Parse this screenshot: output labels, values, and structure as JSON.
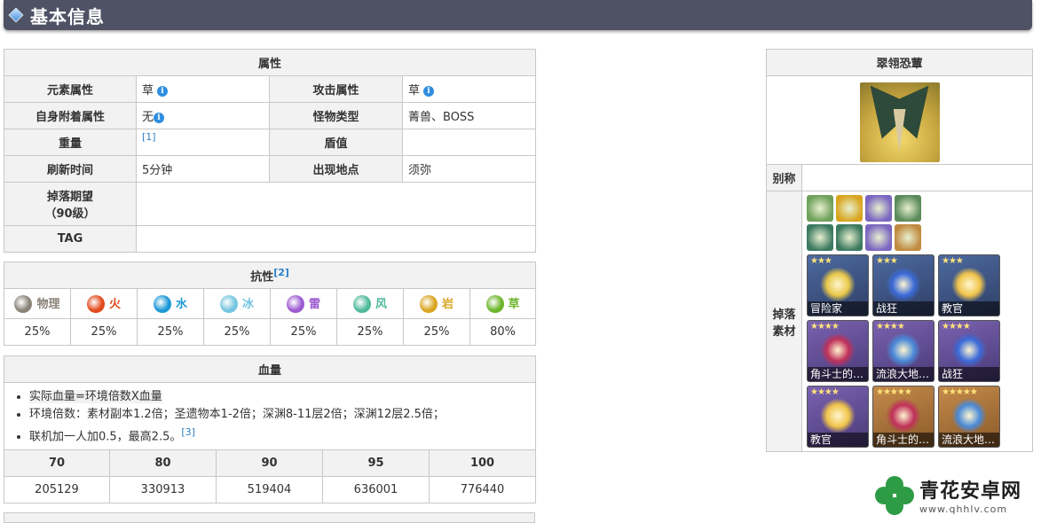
{
  "header": {
    "title": "基本信息"
  },
  "attributes": {
    "title": "属性",
    "rows": [
      {
        "l1": "元素属性",
        "v1": "草",
        "l2": "攻击属性",
        "v2": "草"
      },
      {
        "l1": "自身附着属性",
        "v1": "无",
        "l2": "怪物类型",
        "v2": "菁兽、BOSS"
      },
      {
        "l1": "重量",
        "v1": "",
        "ref1": "[1]",
        "l2": "盾值",
        "v2": ""
      },
      {
        "l1": "刷新时间",
        "v1": "5分钟",
        "l2": "出现地点",
        "v2": "须弥"
      }
    ],
    "drop_label": "掉落期望\n（90级）",
    "drop_label_line1": "掉落期望",
    "drop_label_line2": "（90级）",
    "tag_label": "TAG"
  },
  "resistance": {
    "title": "抗性",
    "ref": "[2]",
    "elements": [
      {
        "name": "物理",
        "color": "#8a8276",
        "value": "25%"
      },
      {
        "name": "火",
        "color": "#e2491a",
        "value": "25%"
      },
      {
        "name": "水",
        "color": "#1c98d6",
        "value": "25%"
      },
      {
        "name": "冰",
        "color": "#74c6e0",
        "value": "25%"
      },
      {
        "name": "雷",
        "color": "#9c5ad1",
        "value": "25%"
      },
      {
        "name": "风",
        "color": "#4fba9a",
        "value": "25%"
      },
      {
        "name": "岩",
        "color": "#d9a520",
        "value": "25%"
      },
      {
        "name": "草",
        "color": "#6cb52a",
        "value": "80%"
      }
    ]
  },
  "hp": {
    "title": "血量",
    "notes": [
      "实际血量=环境倍数X血量",
      "环境倍数：素材副本1.2倍；圣遗物本1-2倍；深渊8-11层2倍；深渊12层2.5倍；",
      "联机加一人加0.5，最高2.5。"
    ],
    "note_ref": "[3]",
    "levels": [
      "70",
      "80",
      "90",
      "95",
      "100"
    ],
    "values": [
      "205129",
      "330913",
      "519404",
      "636001",
      "776440"
    ]
  },
  "infobox": {
    "name": "翠翎恐蕈",
    "alias_label": "别称",
    "alias_value": "",
    "drops_label": "掉落\n素材",
    "drops_label_line1": "掉落",
    "drops_label_line2": "素材",
    "small_icons": [
      {
        "name": "ar-exp-icon",
        "color": "#6fa05a"
      },
      {
        "name": "mora-icon",
        "color": "#d9a520"
      },
      {
        "name": "companionship-icon",
        "color": "#7a66c0"
      },
      {
        "name": "green-feather-icon",
        "color": "#5a8a5a"
      },
      {
        "name": "green-gem-1-icon",
        "color": "#3c7a60"
      },
      {
        "name": "green-gem-2-icon",
        "color": "#3c7a60"
      },
      {
        "name": "green-gem-3-icon",
        "color": "#7a66c0"
      },
      {
        "name": "green-gem-4-icon",
        "color": "#c08a40"
      }
    ],
    "cards": [
      {
        "stars": "★★★",
        "label": "冒险家",
        "rarity": "r3",
        "flower": "#e8c84a"
      },
      {
        "stars": "★★★",
        "label": "战狂",
        "rarity": "r3",
        "flower": "#3b6ad8"
      },
      {
        "stars": "★★★",
        "label": "教官",
        "rarity": "r3",
        "flower": "#f0c44a"
      },
      {
        "stars": "★★★★",
        "label": "角斗士的…",
        "rarity": "r4",
        "flower": "#c0305a"
      },
      {
        "stars": "★★★★",
        "label": "流浪大地…",
        "rarity": "r4",
        "flower": "#4a8ad8"
      },
      {
        "stars": "★★★★",
        "label": "战狂",
        "rarity": "r4",
        "flower": "#3b6ad8"
      },
      {
        "stars": "★★★★",
        "label": "教官",
        "rarity": "r4",
        "flower": "#f0c44a"
      },
      {
        "stars": "★★★★★",
        "label": "角斗士的…",
        "rarity": "r5",
        "flower": "#c0305a"
      },
      {
        "stars": "★★★★★",
        "label": "流浪大地…",
        "rarity": "r5",
        "flower": "#4a8ad8"
      }
    ]
  },
  "watermark": {
    "title": "青花安卓网",
    "url": "www.qhhlv.com"
  }
}
